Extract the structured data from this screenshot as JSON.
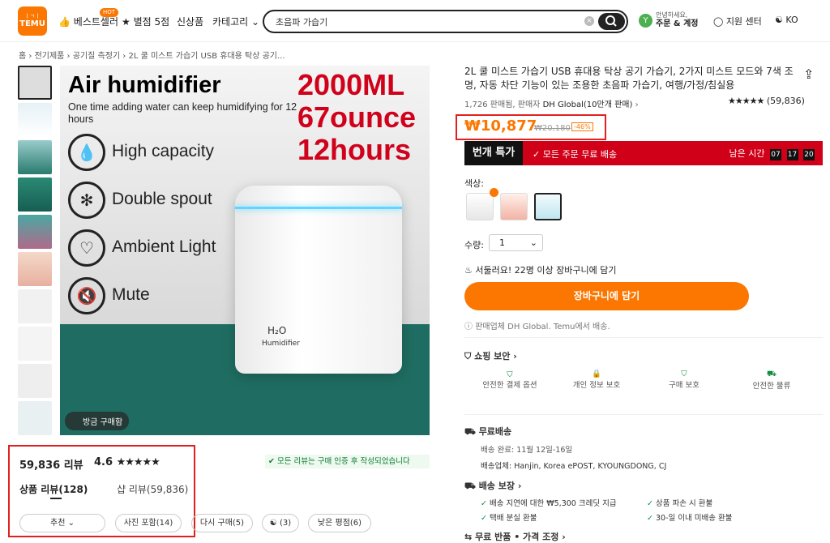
{
  "header": {
    "logo_top": "ㅣㄱㅣ",
    "logo": "TEMU",
    "hot_badge": "HOT",
    "nav": [
      "베스트셀러",
      "별점 5점",
      "신상품",
      "카테고리"
    ],
    "search_value": "초음파 가습기",
    "user_initial": "Y",
    "user_greeting": "안녕하세요,",
    "user_menu": "주문 & 계정",
    "support": "지원 센터",
    "lang": "KO"
  },
  "breadcrumb": [
    "홈",
    "전기제품",
    "공기질 측정기",
    "2L 쿨 미스트 가습기 USB 휴대용 탁상 공기..."
  ],
  "product_image": {
    "title": "Air humidifier",
    "subtitle": "One time adding water can keep humidifying for 12 hours",
    "specs": [
      "2000ML",
      "67ounce",
      "12hours"
    ],
    "features": [
      "High capacity",
      "Double spout",
      "Ambient Light",
      "Mute"
    ],
    "device_text_1": "H₂O",
    "device_text_2": "Humidifier",
    "recent_badge": "방금 구매함"
  },
  "reviews": {
    "count": "59,836 리뷰",
    "rating": "4.6",
    "verified": "모든 리뷰는 구매 인증 후 작성되었습니다",
    "tab_product": "상품 리뷰(128)",
    "tab_shop": "샵 리뷰(59,836)",
    "filters": [
      "추천",
      "사진 포함(14)",
      "다시 구매(5)",
      "(3)",
      "낮은 평점(6)"
    ]
  },
  "product": {
    "title": "2L 쿨 미스트 가습기 USB 휴대용 탁상 공기 가습기, 2가지 미스트 모드와 7색 조명, 자동 차단 기능이 있는 조용한 초음파 가습기, 여행/가정/침실용",
    "sold": "1,726 판매됨,",
    "seller_label": "판매자",
    "seller": "DH Global(10만개 판매)",
    "rating_count": "(59,836)",
    "price": "₩10,877",
    "orig_price": "₩20,180",
    "discount": "-46%",
    "flash_label": "번개 특가",
    "flash_shipping": "모든 주문 무료 배송",
    "time_left": "남은 시간",
    "timer": [
      "07",
      "17",
      "20"
    ],
    "color_label": "색상:",
    "qty_label": "수량:",
    "qty": "1",
    "hurry": "서둘러요! 22명 이상 장바구니에 담기",
    "cart_button": "장바구니에 담기",
    "seller_note": "판매업체 DH Global. Temu에서 배송."
  },
  "safety": {
    "title": "쇼핑 보안",
    "items": [
      "안전한 결제 옵션",
      "개인 정보 보호",
      "구매 보호",
      "안전한 물류"
    ]
  },
  "shipping": {
    "title": "무료배송",
    "delivery": "배송 완료: 11월 12일-16일",
    "carriers_label": "배송업체:",
    "carriers": [
      "Hanjin,",
      "Korea ePOST,",
      "KYOUNGDONG,",
      "CJ"
    ]
  },
  "guarantee": {
    "title": "배송 보장",
    "items": [
      "배송 지연에 대한 ₩5,300 크레딧 지급",
      "상품 파손 시 환불",
      "택배 분실 환불",
      "30-일 이내 미배송 환불"
    ]
  },
  "returns": {
    "title": "무료 반품 • 가격 조정"
  }
}
